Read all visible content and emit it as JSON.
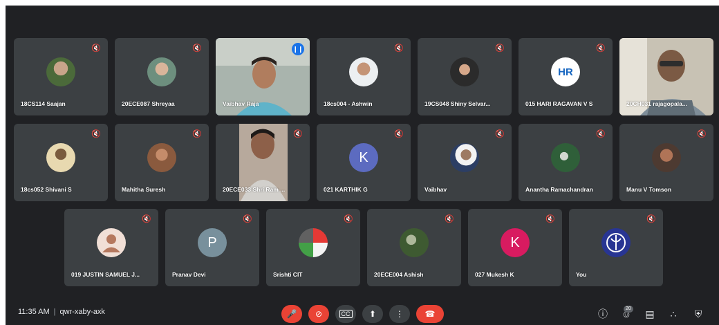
{
  "meeting": {
    "time": "11:35 AM",
    "separator": "|",
    "code": "qwr-xaby-axk"
  },
  "participants_row1": [
    {
      "name": "18CS114 Saajan"
    },
    {
      "name": "20ECE087 Shreyaa"
    },
    {
      "name": "Vaibhav Raja"
    },
    {
      "name": "18cs004 - Ashwin"
    },
    {
      "name": "19CS048 Shiny Selvar..."
    },
    {
      "name": "015 HARI RAGAVAN V S",
      "initials": "HR"
    },
    {
      "name": "20CH031 rajagopala..."
    }
  ],
  "participants_row2": [
    {
      "name": "18cs052 Shivani S"
    },
    {
      "name": "Mahitha Suresh"
    },
    {
      "name": "20ECE033 Shri Ram ..."
    },
    {
      "name": "021 KARTHIK G",
      "initial": "K",
      "color": "#5c6bc0"
    },
    {
      "name": "Vaibhav"
    },
    {
      "name": "Anantha Ramachandran"
    },
    {
      "name": "Manu V Tomson"
    }
  ],
  "participants_row3": [
    {
      "name": "019 JUSTIN SAMUEL J..."
    },
    {
      "name": "Pranav Devi",
      "initial": "P",
      "color": "#78909c"
    },
    {
      "name": "Srishti CIT"
    },
    {
      "name": "20ECE004 Ashish"
    },
    {
      "name": "027 Mukesh K",
      "initial": "K",
      "color": "#d81b60"
    },
    {
      "name": "You"
    }
  ],
  "controls": {
    "participants_count": "20"
  },
  "icons": {
    "muted": "mic-off-icon",
    "speaking": "audio-wave-icon",
    "mic": "mic-off-icon",
    "cam": "camera-off-icon",
    "cc": "captions-icon",
    "present": "present-icon",
    "more": "more-vert-icon",
    "hangup": "hang-up-icon",
    "info": "info-icon",
    "people": "people-icon",
    "chat": "chat-icon",
    "activities": "activities-icon",
    "safety": "host-controls-icon"
  },
  "colors": {
    "background": "#202124",
    "tile": "#3c4043",
    "red": "#ea4335",
    "accent": "#8ab4f8"
  }
}
